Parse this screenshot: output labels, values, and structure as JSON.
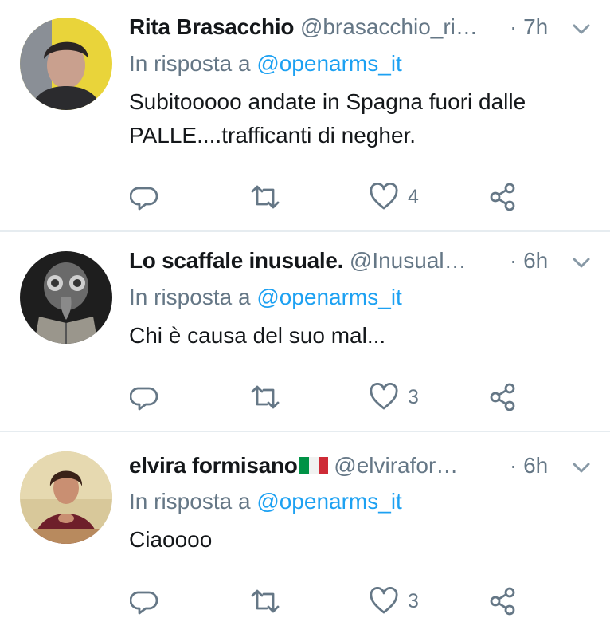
{
  "tweets": [
    {
      "name": "Rita Brasacchio",
      "handle": "@brasacchio_ri…",
      "time": "· 7h",
      "reply_prefix": "In risposta a",
      "reply_to": "@openarms_it",
      "text_lines": [
        "Subitooooo andate in Spagna fuori dalle",
        "PALLE....trafficanti di negher."
      ],
      "likes": "4"
    },
    {
      "name": "Lo scaffale inusuale.",
      "handle": "@Inusual…",
      "time": "· 6h",
      "reply_prefix": "In risposta a",
      "reply_to": "@openarms_it",
      "text_lines": [
        "Chi è causa del suo mal..."
      ],
      "likes": "3"
    },
    {
      "name": "elvira formisano",
      "handle": "@elvirafor…",
      "time": "· 6h",
      "reply_prefix": "In risposta a",
      "reply_to": "@openarms_it",
      "text_lines": [
        "Ciaoooo"
      ],
      "likes": "3"
    }
  ],
  "icons": {
    "reply": "reply-icon",
    "retweet": "retweet-icon",
    "like": "heart-icon",
    "share": "share-icon",
    "more": "chevron-down-icon",
    "flag": "italy-flag-icon"
  },
  "colors": {
    "text": "#14171a",
    "secondary": "#657786",
    "link": "#1da1f2",
    "divider": "#e6ecf0"
  }
}
